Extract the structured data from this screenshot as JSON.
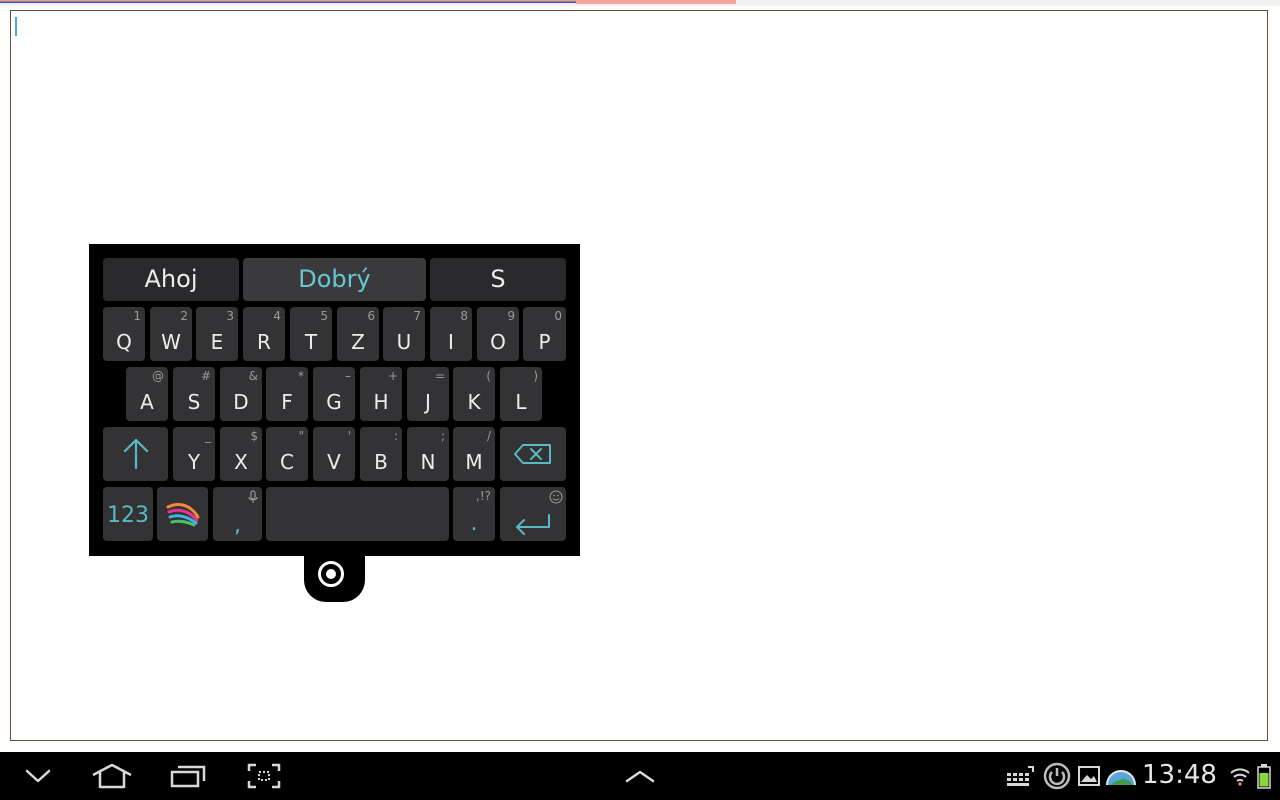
{
  "progress": {
    "fraction": 0.45,
    "buffer_fraction": 0.575
  },
  "text_field": {
    "value": ""
  },
  "keyboard": {
    "suggestions": [
      "Ahoj",
      "Dobrý",
      "S"
    ],
    "active_suggestion": 1,
    "row1": [
      {
        "main": "Q",
        "sub": "1"
      },
      {
        "main": "W",
        "sub": "2"
      },
      {
        "main": "E",
        "sub": "3"
      },
      {
        "main": "R",
        "sub": "4"
      },
      {
        "main": "T",
        "sub": "5"
      },
      {
        "main": "Z",
        "sub": "6"
      },
      {
        "main": "U",
        "sub": "7"
      },
      {
        "main": "I",
        "sub": "8"
      },
      {
        "main": "O",
        "sub": "9"
      },
      {
        "main": "P",
        "sub": "0"
      }
    ],
    "row2": [
      {
        "main": "A",
        "sub": "@"
      },
      {
        "main": "S",
        "sub": "#"
      },
      {
        "main": "D",
        "sub": "&"
      },
      {
        "main": "F",
        "sub": "*"
      },
      {
        "main": "G",
        "sub": "–"
      },
      {
        "main": "H",
        "sub": "+"
      },
      {
        "main": "J",
        "sub": "="
      },
      {
        "main": "K",
        "sub": "("
      },
      {
        "main": "L",
        "sub": ")"
      }
    ],
    "row3": [
      {
        "main": "Y",
        "sub": "_"
      },
      {
        "main": "X",
        "sub": "$"
      },
      {
        "main": "C",
        "sub": "\""
      },
      {
        "main": "V",
        "sub": "'"
      },
      {
        "main": "B",
        "sub": ":"
      },
      {
        "main": "N",
        "sub": ";"
      },
      {
        "main": "M",
        "sub": "/"
      }
    ],
    "numbers_label": "123",
    "comma_label": ",",
    "period_label": ".",
    "period_sub": ",!?",
    "icons": {
      "shift": "shift-arrow-up-icon",
      "backspace": "backspace-icon",
      "swiftkey": "swiftkey-logo-icon",
      "mic": "microphone-icon",
      "smiley": "smiley-icon",
      "enter": "enter-icon",
      "handle": "keyboard-handle-icon"
    },
    "accent_color": "#58b9c2"
  },
  "system_bar": {
    "time": "13:48",
    "icons": [
      "hide-keyboard-icon",
      "home-icon",
      "recent-apps-icon",
      "screenshot-icon",
      "chevron-up-icon",
      "keyboard-icon",
      "power-icon",
      "gallery-icon",
      "weather-icon",
      "wifi-icon",
      "battery-icon"
    ]
  }
}
